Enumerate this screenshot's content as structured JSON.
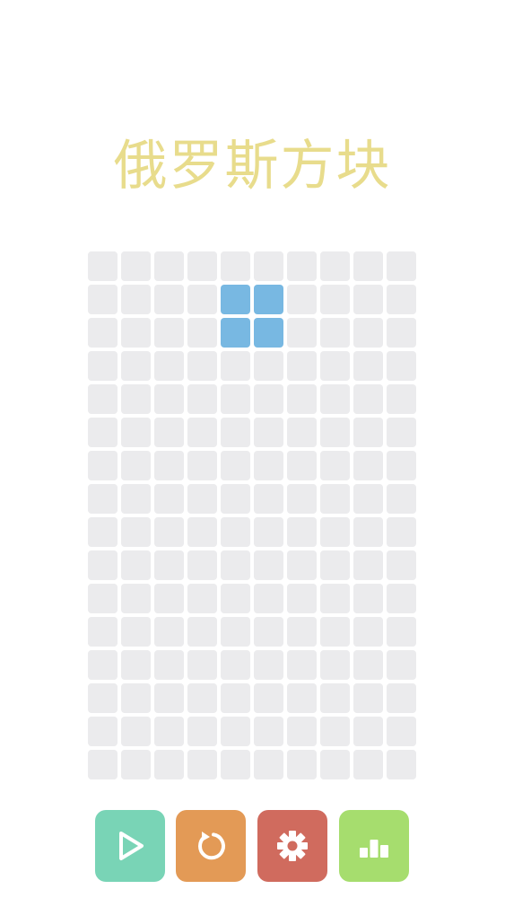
{
  "app": {
    "title": "俄罗斯方块"
  },
  "board": {
    "columns": 10,
    "rows": 16,
    "cell_color": "#ebebed",
    "active_color": "#78b8e2",
    "active_piece": {
      "shape": "O",
      "cells": [
        [
          1,
          4
        ],
        [
          1,
          5
        ],
        [
          2,
          4
        ],
        [
          2,
          5
        ]
      ]
    }
  },
  "controls": [
    {
      "id": "play",
      "icon": "play-icon",
      "color": "#79d4b6"
    },
    {
      "id": "restart",
      "icon": "restart-icon",
      "color": "#e39a56"
    },
    {
      "id": "settings",
      "icon": "gear-icon",
      "color": "#d06b5e"
    },
    {
      "id": "leaderboard",
      "icon": "bar-chart-icon",
      "color": "#a6dd6e"
    }
  ],
  "colors": {
    "title": "#e8dc8c",
    "background": "#ffffff"
  }
}
